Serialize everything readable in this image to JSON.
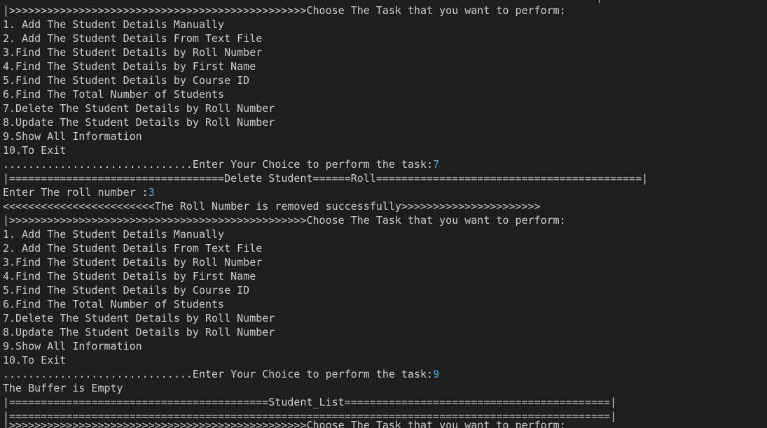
{
  "terminal": {
    "lines": [
      {
        "text": "|>>>>>>>>>>>>>>>>>>>>>>>>>>>>>>>>>>>>>>>>>>>>>>>Choose The Task that you want to perform:",
        "input": ""
      },
      {
        "text": "1. Add The Student Details Manually",
        "input": ""
      },
      {
        "text": "2. Add The Student Details From Text File",
        "input": ""
      },
      {
        "text": "3.Find The Student Details by Roll Number",
        "input": ""
      },
      {
        "text": "4.Find The Student Details by First Name",
        "input": ""
      },
      {
        "text": "5.Find The Student Details by Course ID",
        "input": ""
      },
      {
        "text": "6.Find The Total Number of Students",
        "input": ""
      },
      {
        "text": "7.Delete The Student Details by Roll Number",
        "input": ""
      },
      {
        "text": "8.Update The Student Details by Roll Number",
        "input": ""
      },
      {
        "text": "9.Show All Information",
        "input": ""
      },
      {
        "text": "10.To Exit",
        "input": ""
      },
      {
        "text": "..............................Enter Your Choice to perform the task:",
        "input": "7"
      },
      {
        "text": "|==================================Delete Student======Roll==========================================|",
        "input": ""
      },
      {
        "text": "Enter The roll number :",
        "input": "3"
      },
      {
        "text": "<<<<<<<<<<<<<<<<<<<<<<<<The Roll Number is removed successfully>>>>>>>>>>>>>>>>>>>>>>",
        "input": ""
      },
      {
        "text": "|>>>>>>>>>>>>>>>>>>>>>>>>>>>>>>>>>>>>>>>>>>>>>>>Choose The Task that you want to perform:",
        "input": ""
      },
      {
        "text": "1. Add The Student Details Manually",
        "input": ""
      },
      {
        "text": "2. Add The Student Details From Text File",
        "input": ""
      },
      {
        "text": "3.Find The Student Details by Roll Number",
        "input": ""
      },
      {
        "text": "4.Find The Student Details by First Name",
        "input": ""
      },
      {
        "text": "5.Find The Student Details by Course ID",
        "input": ""
      },
      {
        "text": "6.Find The Total Number of Students",
        "input": ""
      },
      {
        "text": "7.Delete The Student Details by Roll Number",
        "input": ""
      },
      {
        "text": "8.Update The Student Details by Roll Number",
        "input": ""
      },
      {
        "text": "9.Show All Information",
        "input": ""
      },
      {
        "text": "10.To Exit",
        "input": ""
      },
      {
        "text": "..............................Enter Your Choice to perform the task:",
        "input": "9"
      },
      {
        "text": "The Buffer is Empty",
        "input": ""
      },
      {
        "text": "|=========================================Student_List==========================================|",
        "input": ""
      },
      {
        "text": "|===============================================================================================|",
        "input": ""
      }
    ],
    "partial_line": "|>>>>>>>>>>>>>>>>>>>>>>>>>>>>>>>>>>>>>>>>>>>>>>>Choose The Task that you want to perform:",
    "colors": {
      "background": "#1e1e1e",
      "text": "#cccccc",
      "user_input": "#4fa8d8"
    }
  }
}
